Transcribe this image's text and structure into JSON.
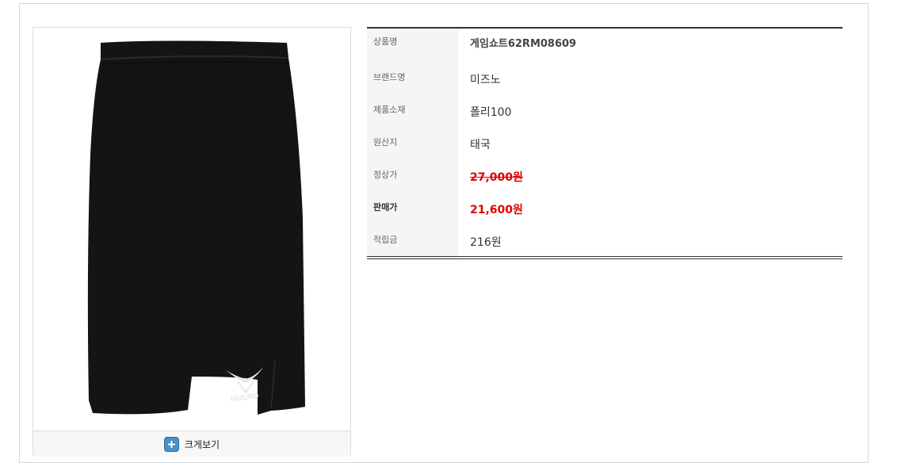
{
  "product": {
    "image_alt": "Black Mizuno game shorts",
    "logo_text": "MIZUNO",
    "zoom_label": "크게보기"
  },
  "info": {
    "rows": [
      {
        "label": "상품명",
        "value": "게임쇼트62RM08609"
      },
      {
        "label": "브랜드명",
        "value": "미즈노"
      },
      {
        "label": "제품소재",
        "value": "폴리100"
      },
      {
        "label": "원산지",
        "value": "태국"
      },
      {
        "label": "정상가",
        "value": "27,000원"
      },
      {
        "label": "판매가",
        "value": "21,600원"
      },
      {
        "label": "적립금",
        "value": "216원"
      }
    ]
  },
  "colors": {
    "price_red": "#e00000",
    "zoom_icon_blue": "#4a90c8"
  }
}
